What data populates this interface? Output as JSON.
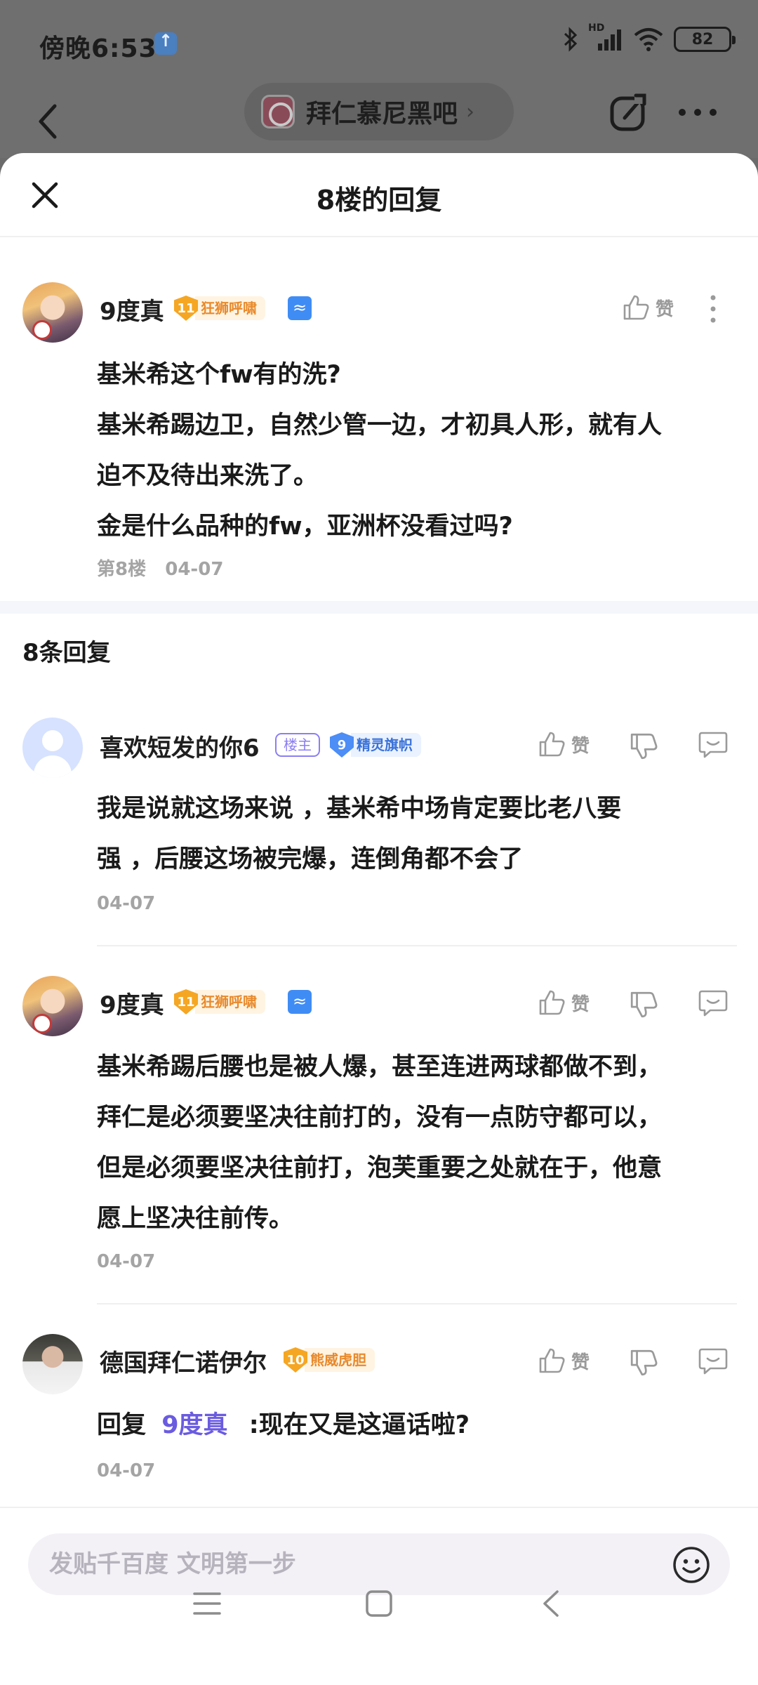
{
  "status_bar": {
    "time": "傍晚6:53",
    "battery": "82",
    "network": "HD"
  },
  "forum_nav": {
    "forum_name": "拜仁慕尼黑吧",
    "chevron": "›"
  },
  "sheet": {
    "title": "8楼的回复"
  },
  "main_post": {
    "username": "9度真",
    "level": "11",
    "level_title": "狂狮呼啸",
    "like_label": "赞",
    "lines": [
      "基米希这个fw有的洗?",
      "基米希踢边卫，自然少管一边，才初具人形，就有人",
      "迫不及待出来洗了。",
      "金是什么品种的fw，亚洲杯没看过吗?"
    ],
    "floor": "第8楼",
    "date": "04-07"
  },
  "replies_header": "8条回复",
  "replies": [
    {
      "username": "喜欢短发的你6",
      "owner_tag": "楼主",
      "level": "9",
      "level_title": "精灵旗帜",
      "like_label": "赞",
      "lines": [
        "我是说就这场来说 ，基米希中场肯定要比老八要",
        "强 ，后腰这场被完爆，连倒角都不会了"
      ],
      "date": "04-07"
    },
    {
      "username": "9度真",
      "level": "11",
      "level_title": "狂狮呼啸",
      "like_label": "赞",
      "lines": [
        "基米希踢后腰也是被人爆，甚至连进两球都做不到，",
        "拜仁是必须要坚决往前打的，没有一点防守都可以，",
        "但是必须要坚决往前打，泡芙重要之处就在于，他意",
        "愿上坚决往前传。"
      ],
      "date": "04-07"
    },
    {
      "username": "德国拜仁诺伊尔",
      "level": "10",
      "level_title": "熊威虎胆",
      "like_label": "赞",
      "reply_prefix": "回复",
      "reply_to": "9度真",
      "reply_text": ":现在又是这逼话啦?",
      "date": "04-07"
    }
  ],
  "composer": {
    "placeholder": "发贴千百度 文明第一步"
  },
  "colors": {
    "accent_purple": "#6a5be0",
    "level_orange": "#f5a623",
    "level_blue": "#4c8df6"
  }
}
